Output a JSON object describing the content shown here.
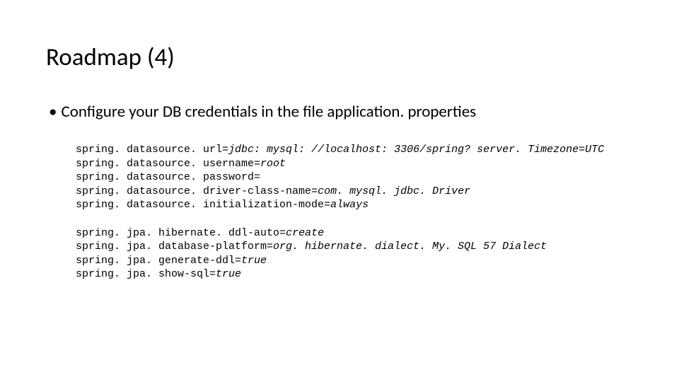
{
  "title": "Roadmap (4)",
  "bullet": {
    "marker": "•",
    "text": "Configure your DB credentials in the file application. properties"
  },
  "code1": {
    "l0k": "spring. datasource. url=",
    "l0v": "jdbc: mysql: //localhost: 3306/spring? server. Timezone=UTC",
    "l1k": "spring. datasource. username=",
    "l1v": "root",
    "l2k": "spring. datasource. password=",
    "l2v": "",
    "l3k": "spring. datasource. driver-class-name=",
    "l3v": "com. mysql. jdbc. Driver",
    "l4k": "spring. datasource. initialization-mode=",
    "l4v": "always"
  },
  "code2": {
    "l0k": "spring. jpa. hibernate. ddl-auto=",
    "l0v": "create",
    "l1k": "spring. jpa. database-platform=",
    "l1v": "org. hibernate. dialect. My. SQL 57 Dialect",
    "l2k": "spring. jpa. generate-ddl=",
    "l2v": "true",
    "l3k": "spring. jpa. show-sql=",
    "l3v": "true"
  }
}
